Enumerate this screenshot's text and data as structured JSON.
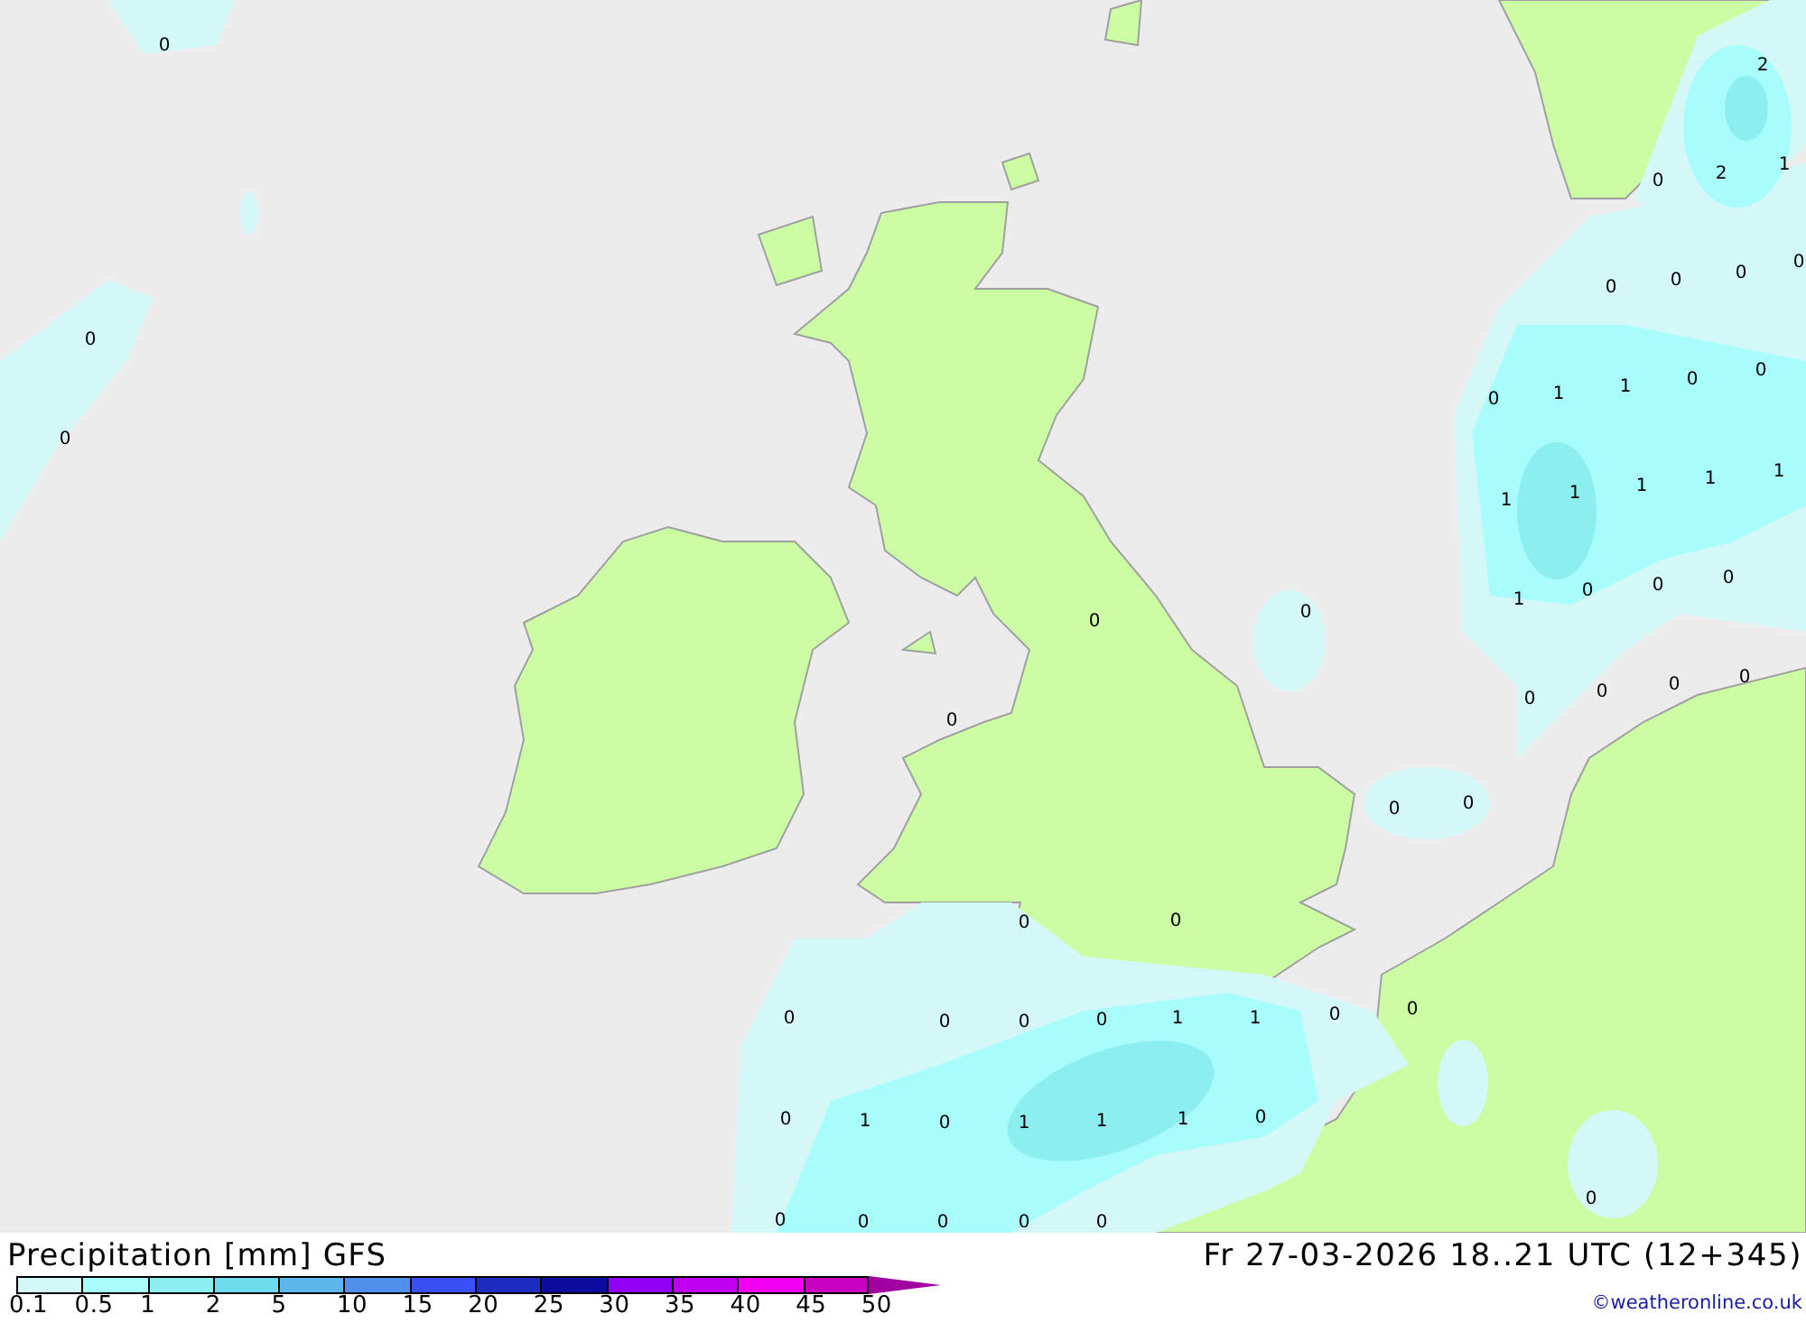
{
  "map": {
    "value_labels": [
      "0",
      "2",
      "2",
      "1",
      "0",
      "0",
      "0",
      "0",
      "0",
      "0",
      "0",
      "0",
      "1",
      "1",
      "0",
      "0",
      "1",
      "1",
      "1",
      "1",
      "1",
      "1",
      "0",
      "0",
      "0",
      "0",
      "0",
      "0",
      "0",
      "0",
      "0",
      "0",
      "0",
      "0",
      "0",
      "0",
      "0",
      "0",
      "0",
      "0",
      "1",
      "1",
      "0",
      "0",
      "0",
      "1",
      "0",
      "1",
      "1",
      "1",
      "0",
      "0",
      "0",
      "0",
      "0",
      "0",
      "0"
    ]
  },
  "legend": {
    "title": "Precipitation [mm] GFS",
    "scale": [
      {
        "label": "0.1",
        "color": "#d4f8f8",
        "kind": "box"
      },
      {
        "label": "0.5",
        "color": "#a8fcfc",
        "kind": "box"
      },
      {
        "label": "1",
        "color": "#8ceeee",
        "kind": "box"
      },
      {
        "label": "2",
        "color": "#6cdcec",
        "kind": "box"
      },
      {
        "label": "5",
        "color": "#5cb8ec",
        "kind": "box"
      },
      {
        "label": "10",
        "color": "#5090ec",
        "kind": "box"
      },
      {
        "label": "15",
        "color": "#3850f4",
        "kind": "box"
      },
      {
        "label": "20",
        "color": "#1c2cc0",
        "kind": "box"
      },
      {
        "label": "25",
        "color": "#0c0ca0",
        "kind": "box"
      },
      {
        "label": "30",
        "color": "#9000f4",
        "kind": "box"
      },
      {
        "label": "35",
        "color": "#c000f0",
        "kind": "box"
      },
      {
        "label": "40",
        "color": "#f000f0",
        "kind": "box"
      },
      {
        "label": "45",
        "color": "#c800c0",
        "kind": "box"
      },
      {
        "label": "50",
        "color": "#a000a0",
        "kind": "arrow"
      }
    ]
  },
  "valid_time": "Fr 27-03-2026 18..21 UTC (12+345)",
  "credit": "©weatheronline.co.uk"
}
